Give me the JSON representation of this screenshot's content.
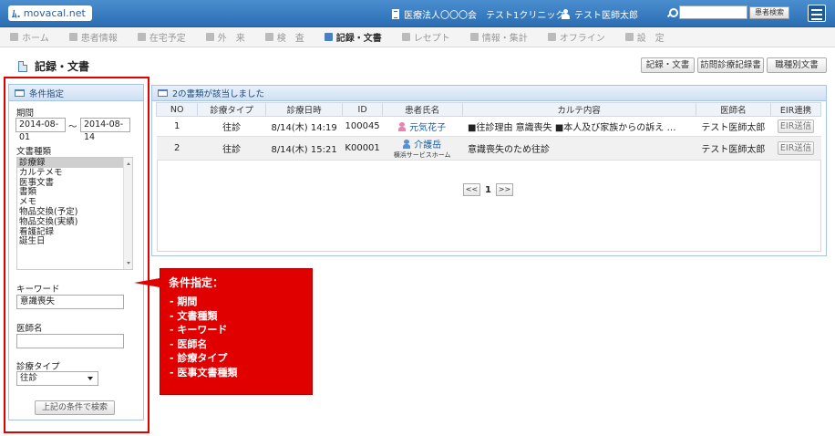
{
  "header": {
    "logo": "movacal.net",
    "clinic": "医療法人〇〇〇会　テスト1クリニック",
    "user": "テスト医師太郎",
    "search_button": "患者検索",
    "search_value": ""
  },
  "nav": [
    {
      "label": "ホーム",
      "active": false,
      "icon": "home-icon"
    },
    {
      "label": "患者情報",
      "active": false,
      "icon": "patient-icon"
    },
    {
      "label": "在宅予定",
      "active": false,
      "icon": "schedule-icon"
    },
    {
      "label": "外　来",
      "active": false,
      "icon": "outpatient-icon"
    },
    {
      "label": "検　査",
      "active": false,
      "icon": "exam-icon"
    },
    {
      "label": "記録・文書",
      "active": true,
      "icon": "document-icon"
    },
    {
      "label": "レセプト",
      "active": false,
      "icon": "receipt-icon"
    },
    {
      "label": "情報・集計",
      "active": false,
      "icon": "stats-icon"
    },
    {
      "label": "オフライン",
      "active": false,
      "icon": "offline-icon"
    },
    {
      "label": "設　定",
      "active": false,
      "icon": "settings-icon"
    }
  ],
  "page": {
    "title": "記録・文書",
    "tabs": [
      "記録・文書",
      "訪問診療記録書",
      "職種別文書"
    ]
  },
  "sidebar": {
    "header": "条件指定",
    "period_label": "期間",
    "date_from": "2014-08-01",
    "tilde": "～",
    "date_to": "2014-08-14",
    "doc_type_label": "文書種類",
    "doc_types": [
      "診療録",
      "カルテメモ",
      "医事文書",
      "書類",
      "メモ",
      "物品交換(予定)",
      "物品交換(実績)",
      "看護記録",
      "誕生日"
    ],
    "keyword_label": "キーワード",
    "keyword_value": "意識喪失",
    "doctor_label": "医師名",
    "doctor_value": "",
    "visit_type_label": "診療タイプ",
    "visit_type_value": "往診",
    "search_button": "上記の条件で検索"
  },
  "results": {
    "header": "2の書類が該当しました",
    "columns": [
      "NO",
      "診療タイプ",
      "診療日時",
      "ID",
      "患者氏名",
      "カルテ内容",
      "医師名",
      "EIR連携"
    ],
    "rows": [
      {
        "no": "1",
        "type": "往診",
        "datetime": "8/14(木) 14:19",
        "id": "100045",
        "patient": "元気花子",
        "patient_sub": "",
        "content": "■往診理由 意識喪失 ■本人及び家族からの訴え …",
        "doctor": "テスト医師太郎",
        "eir": "EIR送信"
      },
      {
        "no": "2",
        "type": "往診",
        "datetime": "8/14(木) 15:21",
        "id": "K00001",
        "patient": "介護岳",
        "patient_sub": "横浜サービスホーム",
        "content": "意識喪失のため往診",
        "doctor": "テスト医師太郎",
        "eir": "EIR送信"
      }
    ],
    "pager": {
      "prev": "<<",
      "page": "1",
      "next": ">>"
    }
  },
  "callout": {
    "title": "条件指定：",
    "items": [
      "- 期間",
      "- 文書種類",
      "- キーワード",
      "- 医師名",
      "- 診療タイプ",
      "- 医事文書種類"
    ]
  },
  "colors": {
    "accent": "#2b6db2",
    "highlight": "#e00000"
  }
}
